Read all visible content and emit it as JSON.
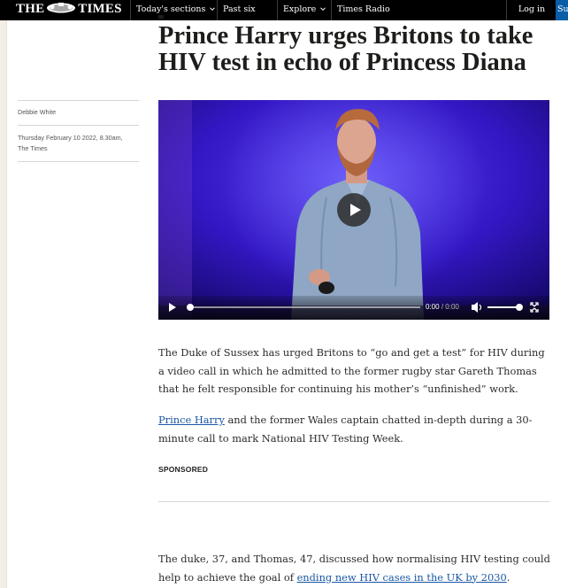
{
  "nav": {
    "logo_text_left": "THE",
    "logo_text_right": "TIMES",
    "items": [
      {
        "label": "Today's sections",
        "has_dropdown": true
      },
      {
        "label": "Past six days",
        "has_dropdown": false
      },
      {
        "label": "Explore",
        "has_dropdown": true
      },
      {
        "label": "Times Radio",
        "has_dropdown": false
      }
    ],
    "login_label": "Log in",
    "subscribe_label": "Subscribe"
  },
  "article": {
    "headline": "Prince Harry urges Britons to take HIV test in echo of Princess Diana",
    "author": "Debbie White",
    "published": "Thursday February 10 2022, 8.30am, The Times",
    "video": {
      "current_time": "0:00",
      "separator": "/",
      "duration": "0:00",
      "progress": 0,
      "volume": 1.0
    },
    "paragraphs": {
      "p1": "The Duke of Sussex has urged Britons to “go and get a test” for HIV during a video call in which he admitted to the former rugby star Gareth Thomas that he felt responsible for continuing his mother’s “unfinished” work.",
      "p2_link": "Prince Harry",
      "p2_rest": " and the former Wales captain chatted in-depth during a 30-minute call to mark National HIV Testing Week.",
      "p3_start": "The duke, 37, and Thomas, 47, discussed how normalising HIV testing could help to achieve the goal of ",
      "p3_link": "ending new HIV cases in the UK by 2030",
      "p3_end": "."
    },
    "sponsored_label": "SPONSORED"
  },
  "colors": {
    "nav_bg": "#000000",
    "link": "#1a57a5",
    "subscribe_bg": "#0a5ea8",
    "video_bg": "#2c19b8"
  }
}
